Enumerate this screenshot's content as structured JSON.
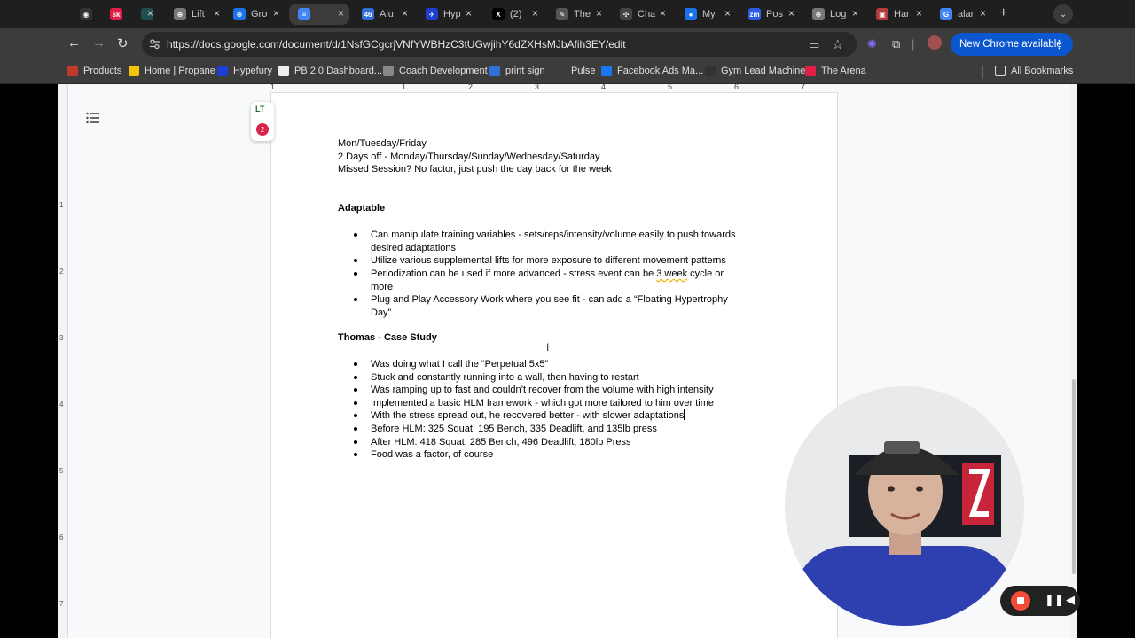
{
  "tabs": [
    {
      "title": "",
      "color": "#333333",
      "glyph": "◉"
    },
    {
      "title": "",
      "color": "#e11d48",
      "glyph": "sk"
    },
    {
      "title": "",
      "color": "#1f4f4f",
      "glyph": ""
    },
    {
      "title": "Lift",
      "color": "#777777",
      "glyph": "⊕"
    },
    {
      "title": "Gro",
      "color": "#1a73e8",
      "glyph": "⊕"
    },
    {
      "title": "",
      "color": "#4285f4",
      "glyph": "≡"
    },
    {
      "title": "Alu",
      "color": "#2f6fd8",
      "glyph": "46"
    },
    {
      "title": "Hyp",
      "color": "#1c3fd1",
      "glyph": "✈"
    },
    {
      "title": "(2)",
      "color": "#000000",
      "glyph": "X"
    },
    {
      "title": "The",
      "color": "#555555",
      "glyph": "✎"
    },
    {
      "title": "Cha",
      "color": "#444444",
      "glyph": "✣"
    },
    {
      "title": "My",
      "color": "#1a73e8",
      "glyph": "●"
    },
    {
      "title": "Pos",
      "color": "#2d5be3",
      "glyph": "zm"
    },
    {
      "title": "Log",
      "color": "#777777",
      "glyph": "⊕"
    },
    {
      "title": "Har",
      "color": "#b23b3b",
      "glyph": "▣"
    },
    {
      "title": "alar",
      "color": "#4285f4",
      "glyph": "G"
    }
  ],
  "toolbar": {
    "url": "https://docs.google.com/document/d/1NsfGCgcrjVNfYWBHzC3tUGwjihY6dZXHsMJbAfih3EY/edit",
    "update_label": "New Chrome available"
  },
  "bookmarks": [
    {
      "label": "Products",
      "color": "#c0392b"
    },
    {
      "label": "Home | Propane",
      "color": "#f4c20d"
    },
    {
      "label": "Hypefury",
      "color": "#1c3fd1"
    },
    {
      "label": "PB 2.0 Dashboard...",
      "color": "#eeeeee"
    },
    {
      "label": "Coach Development",
      "color": "#888888"
    },
    {
      "label": "print sign",
      "color": "#2f6fd8"
    },
    {
      "label": "Pulse",
      "color": "#3c3c3c"
    },
    {
      "label": "Facebook Ads Ma...",
      "color": "#1877f2"
    },
    {
      "label": "Gym Lead Machine",
      "color": "#333333"
    },
    {
      "label": "The Arena",
      "color": "#e11d48"
    },
    {
      "label": "All Bookmarks",
      "color": "#3c3c3c"
    }
  ],
  "ruler": {
    "h_numbers": [
      "1",
      "1",
      "2",
      "3",
      "4",
      "5",
      "6",
      "7"
    ],
    "v_numbers": [
      "1",
      "2",
      "3",
      "4",
      "5",
      "6",
      "7"
    ]
  },
  "languagetool": {
    "logo": "LT",
    "issues": "2"
  },
  "document": {
    "schedule_lines": [
      "Mon/Tuesday/Friday",
      "2 Days off - Monday/Thursday/Sunday/Wednesday/Saturday",
      "Missed Session? No factor, just push the day back for the week"
    ],
    "section1_title": "Adaptable",
    "section1_bullets": [
      {
        "lines": [
          "Can manipulate training variables - sets/reps/intensity/volume easily to push towards",
          "desired adaptations"
        ]
      },
      {
        "lines": [
          "Utilize various supplemental lifts for more exposure to different movement patterns"
        ]
      },
      {
        "lines": [
          "Periodization can be used if more advanced - stress event can be ",
          "more"
        ],
        "flagged": "3 week",
        "after_flag": " cycle or"
      },
      {
        "lines": [
          "Plug and Play Accessory Work where you see fit - can add a “Floating Hypertrophy",
          "Day”"
        ]
      }
    ],
    "section2_title": "Thomas - Case Study",
    "section2_bullets": [
      "Was doing what I call the “Perpetual 5x5”",
      "Stuck and constantly running into a wall, then having to restart",
      "Was ramping up to fast and couldn’t recover from the volume with high intensity",
      "Implemented a basic HLM framework - which got more tailored to him over time",
      "With the stress spread out, he recovered better - with slower adaptations",
      "Before HLM: 325 Squat, 195 Bench, 335 Deadlift, and 135lb press",
      "After HLM: 418 Squat, 285 Bench, 496 Deadlift, 180lb Press",
      "Food was a factor, of course"
    ]
  },
  "colors": {
    "accent": "#0b57d0",
    "record": "#f24b36",
    "badge": "#d9234a"
  }
}
